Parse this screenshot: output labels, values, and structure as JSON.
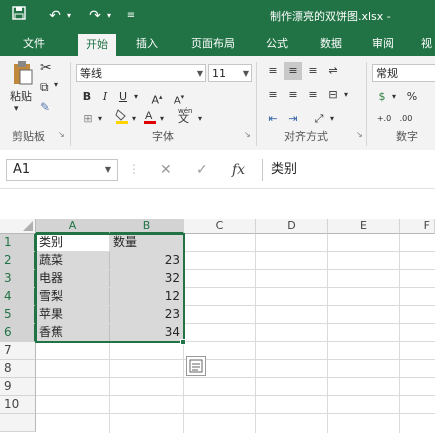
{
  "window": {
    "title": "制作漂亮的双饼图.xlsx -"
  },
  "quick_access": {
    "save_icon": "save-icon",
    "undo_icon": "undo-icon",
    "redo_icon": "redo-icon",
    "customize_icon": "customize-icon"
  },
  "tabs": [
    "文件",
    "开始",
    "插入",
    "页面布局",
    "公式",
    "数据",
    "审阅",
    "视"
  ],
  "ribbon": {
    "clipboard": {
      "paste_label": "粘贴",
      "group_label": "剪贴板"
    },
    "font": {
      "name": "等线",
      "size": "11",
      "bold": "B",
      "italic": "I",
      "underline": "U",
      "grow": "A",
      "shrink": "A",
      "group_label": "字体",
      "wen": "wén",
      "wen_char": "文"
    },
    "alignment": {
      "group_label": "对齐方式"
    },
    "number": {
      "format": "常规",
      "percent": "%",
      "group_label": "数字"
    }
  },
  "formula_bar": {
    "name_box": "A1",
    "fx": "fx",
    "cancel": "✕",
    "enter": "✓",
    "content": "类别"
  },
  "columns": [
    "A",
    "B",
    "C",
    "D",
    "E",
    "F"
  ],
  "rows": [
    "1",
    "2",
    "3",
    "4",
    "5",
    "6",
    "7",
    "8",
    "9",
    "10"
  ],
  "cells": [
    [
      "类别",
      "数量"
    ],
    [
      "蔬菜",
      "23"
    ],
    [
      "电器",
      "32"
    ],
    [
      "雪梨",
      "12"
    ],
    [
      "苹果",
      "23"
    ],
    [
      "香蕉",
      "34"
    ]
  ],
  "colors": {
    "accent": "#217346",
    "selection": "#d9d9d9"
  }
}
